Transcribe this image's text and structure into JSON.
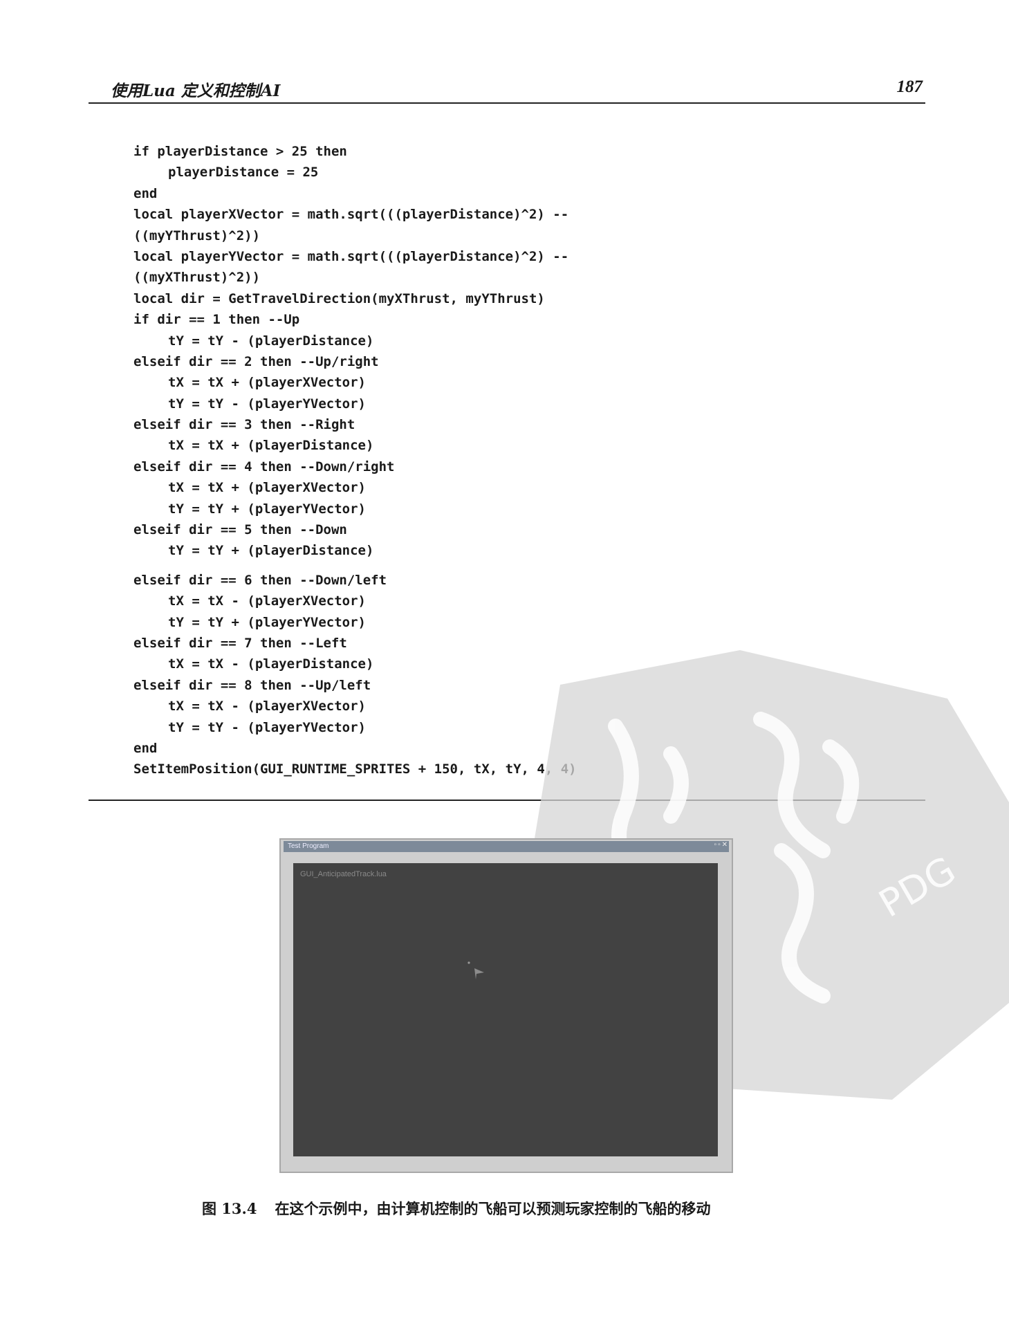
{
  "header": {
    "title": "使用Lua 定义和控制AI",
    "page_number": "187"
  },
  "code": {
    "lines": [
      "if playerDistance > 25 then",
      "playerDistance = 25",
      "end",
      "local playerXVector = math.sqrt(((playerDistance)^2) --",
      "((myYThrust)^2))",
      "local playerYVector = math.sqrt(((playerDistance)^2) --",
      "((myXThrust)^2))",
      "local dir = GetTravelDirection(myXThrust, myYThrust)",
      "if dir == 1 then --Up",
      "tY = tY - (playerDistance)",
      "elseif dir == 2 then --Up/right",
      "tX = tX + (playerXVector)",
      "tY = tY - (playerYVector)",
      "elseif dir == 3 then --Right",
      "tX = tX + (playerDistance)",
      "elseif dir == 4 then --Down/right",
      "tX = tX + (playerXVector)",
      "tY = tY + (playerYVector)",
      "elseif dir == 5 then --Down",
      "tY = tY + (playerDistance)",
      "elseif dir == 6 then --Down/left",
      "tX = tX - (playerXVector)",
      "tY = tY + (playerYVector)",
      "elseif dir == 7 then --Left",
      "tX = tX - (playerDistance)",
      "elseif dir == 8 then --Up/left",
      "tX = tX - (playerXVector)",
      "tY = tY - (playerYVector)",
      "end",
      "SetItemPosition(GUI_RUNTIME_SPRITES + 150, tX, tY, 4, 4)"
    ]
  },
  "figure": {
    "window_title": "Test Program",
    "screen_label": "GUI_AnticipatedTrack.lua",
    "caption_label": "图 13.4",
    "caption_text": "在这个示例中，由计算机控制的飞船可以预测玩家控制的飞船的移动"
  },
  "watermark": {
    "text": "PDG"
  }
}
